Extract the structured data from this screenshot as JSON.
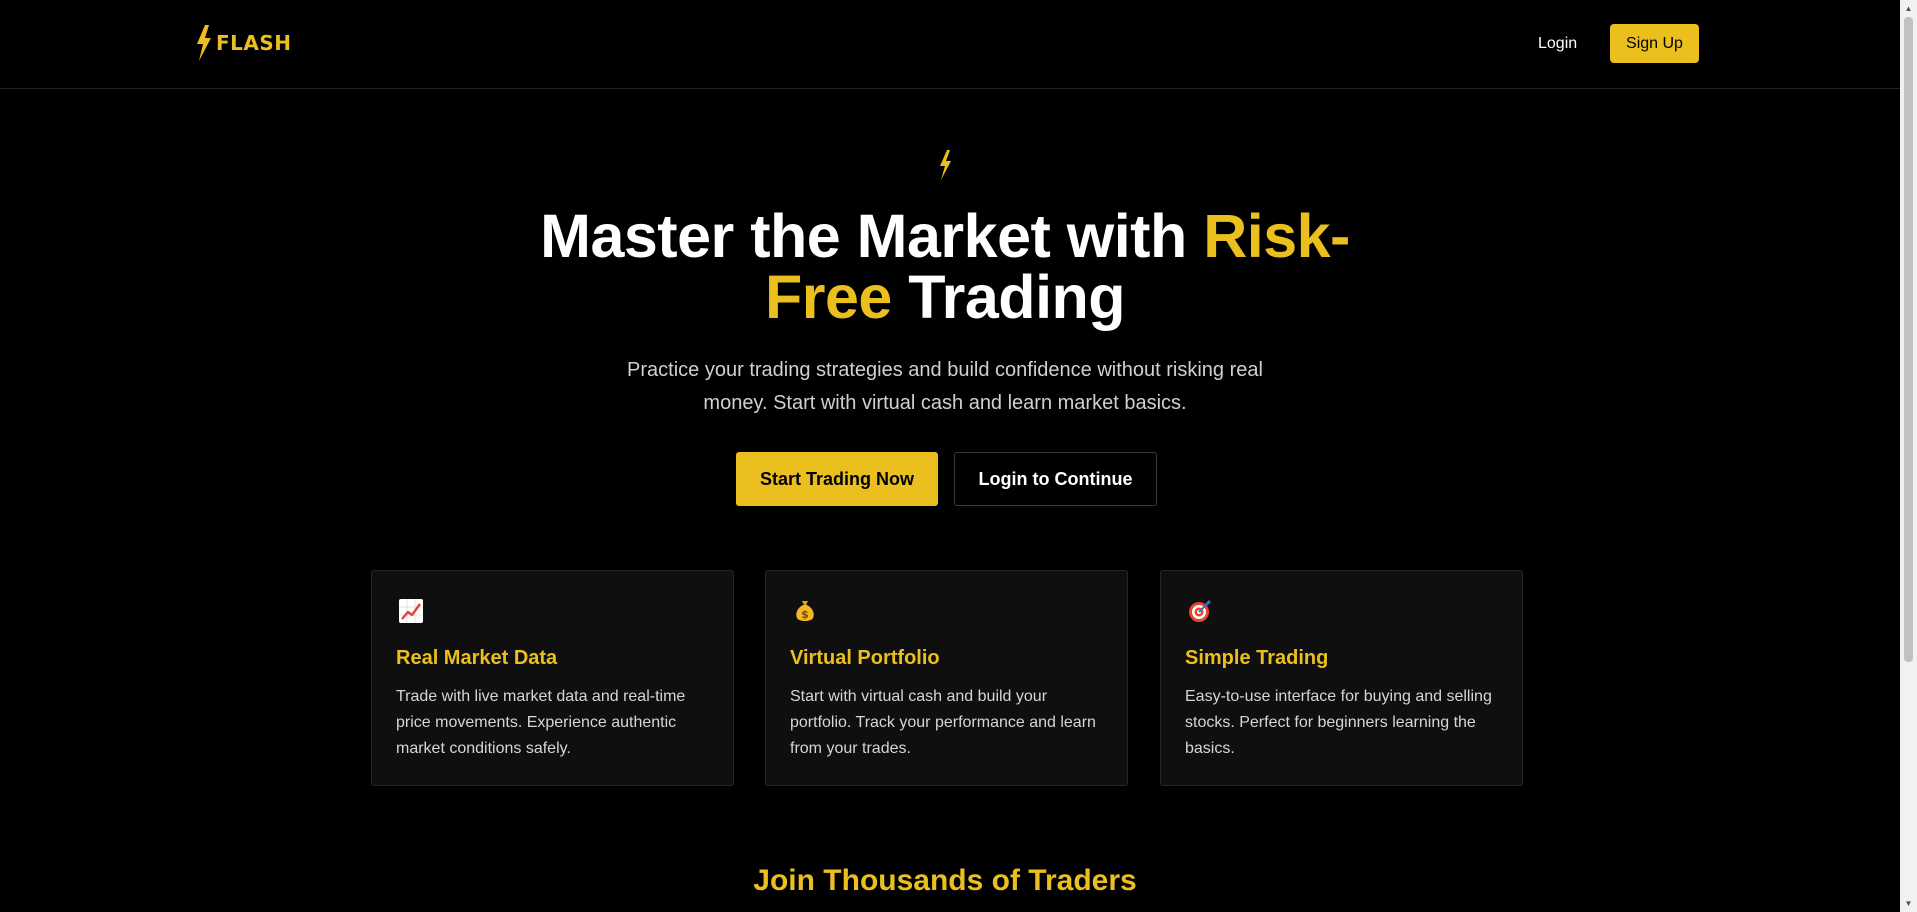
{
  "brand": {
    "name": "FLASH",
    "accent_color": "#eabf1e",
    "logo_icon": "lightning-bolt-icon"
  },
  "nav": {
    "login_label": "Login",
    "signup_label": "Sign Up"
  },
  "hero": {
    "icon": "lightning-bolt-icon",
    "title_part1": "Master the Market with ",
    "title_accent_1": "Risk-",
    "title_accent_2": "Free",
    "title_part2": " Trading",
    "subtitle": "Practice your trading strategies and build confidence without risking real money. Start with virtual cash and learn market basics.",
    "primary_cta": "Start Trading Now",
    "secondary_cta": "Login to Continue"
  },
  "features": [
    {
      "icon": "chart-increasing-icon",
      "title": "Real Market Data",
      "text": "Trade with live market data and real-time price movements. Experience authentic market conditions safely."
    },
    {
      "icon": "money-bag-icon",
      "title": "Virtual Portfolio",
      "text": "Start with virtual cash and build your portfolio. Track your performance and learn from your trades."
    },
    {
      "icon": "target-icon",
      "title": "Simple Trading",
      "text": "Easy-to-use interface for buying and selling stocks. Perfect for beginners learning the basics."
    }
  ],
  "join": {
    "title": "Join Thousands of Traders"
  }
}
